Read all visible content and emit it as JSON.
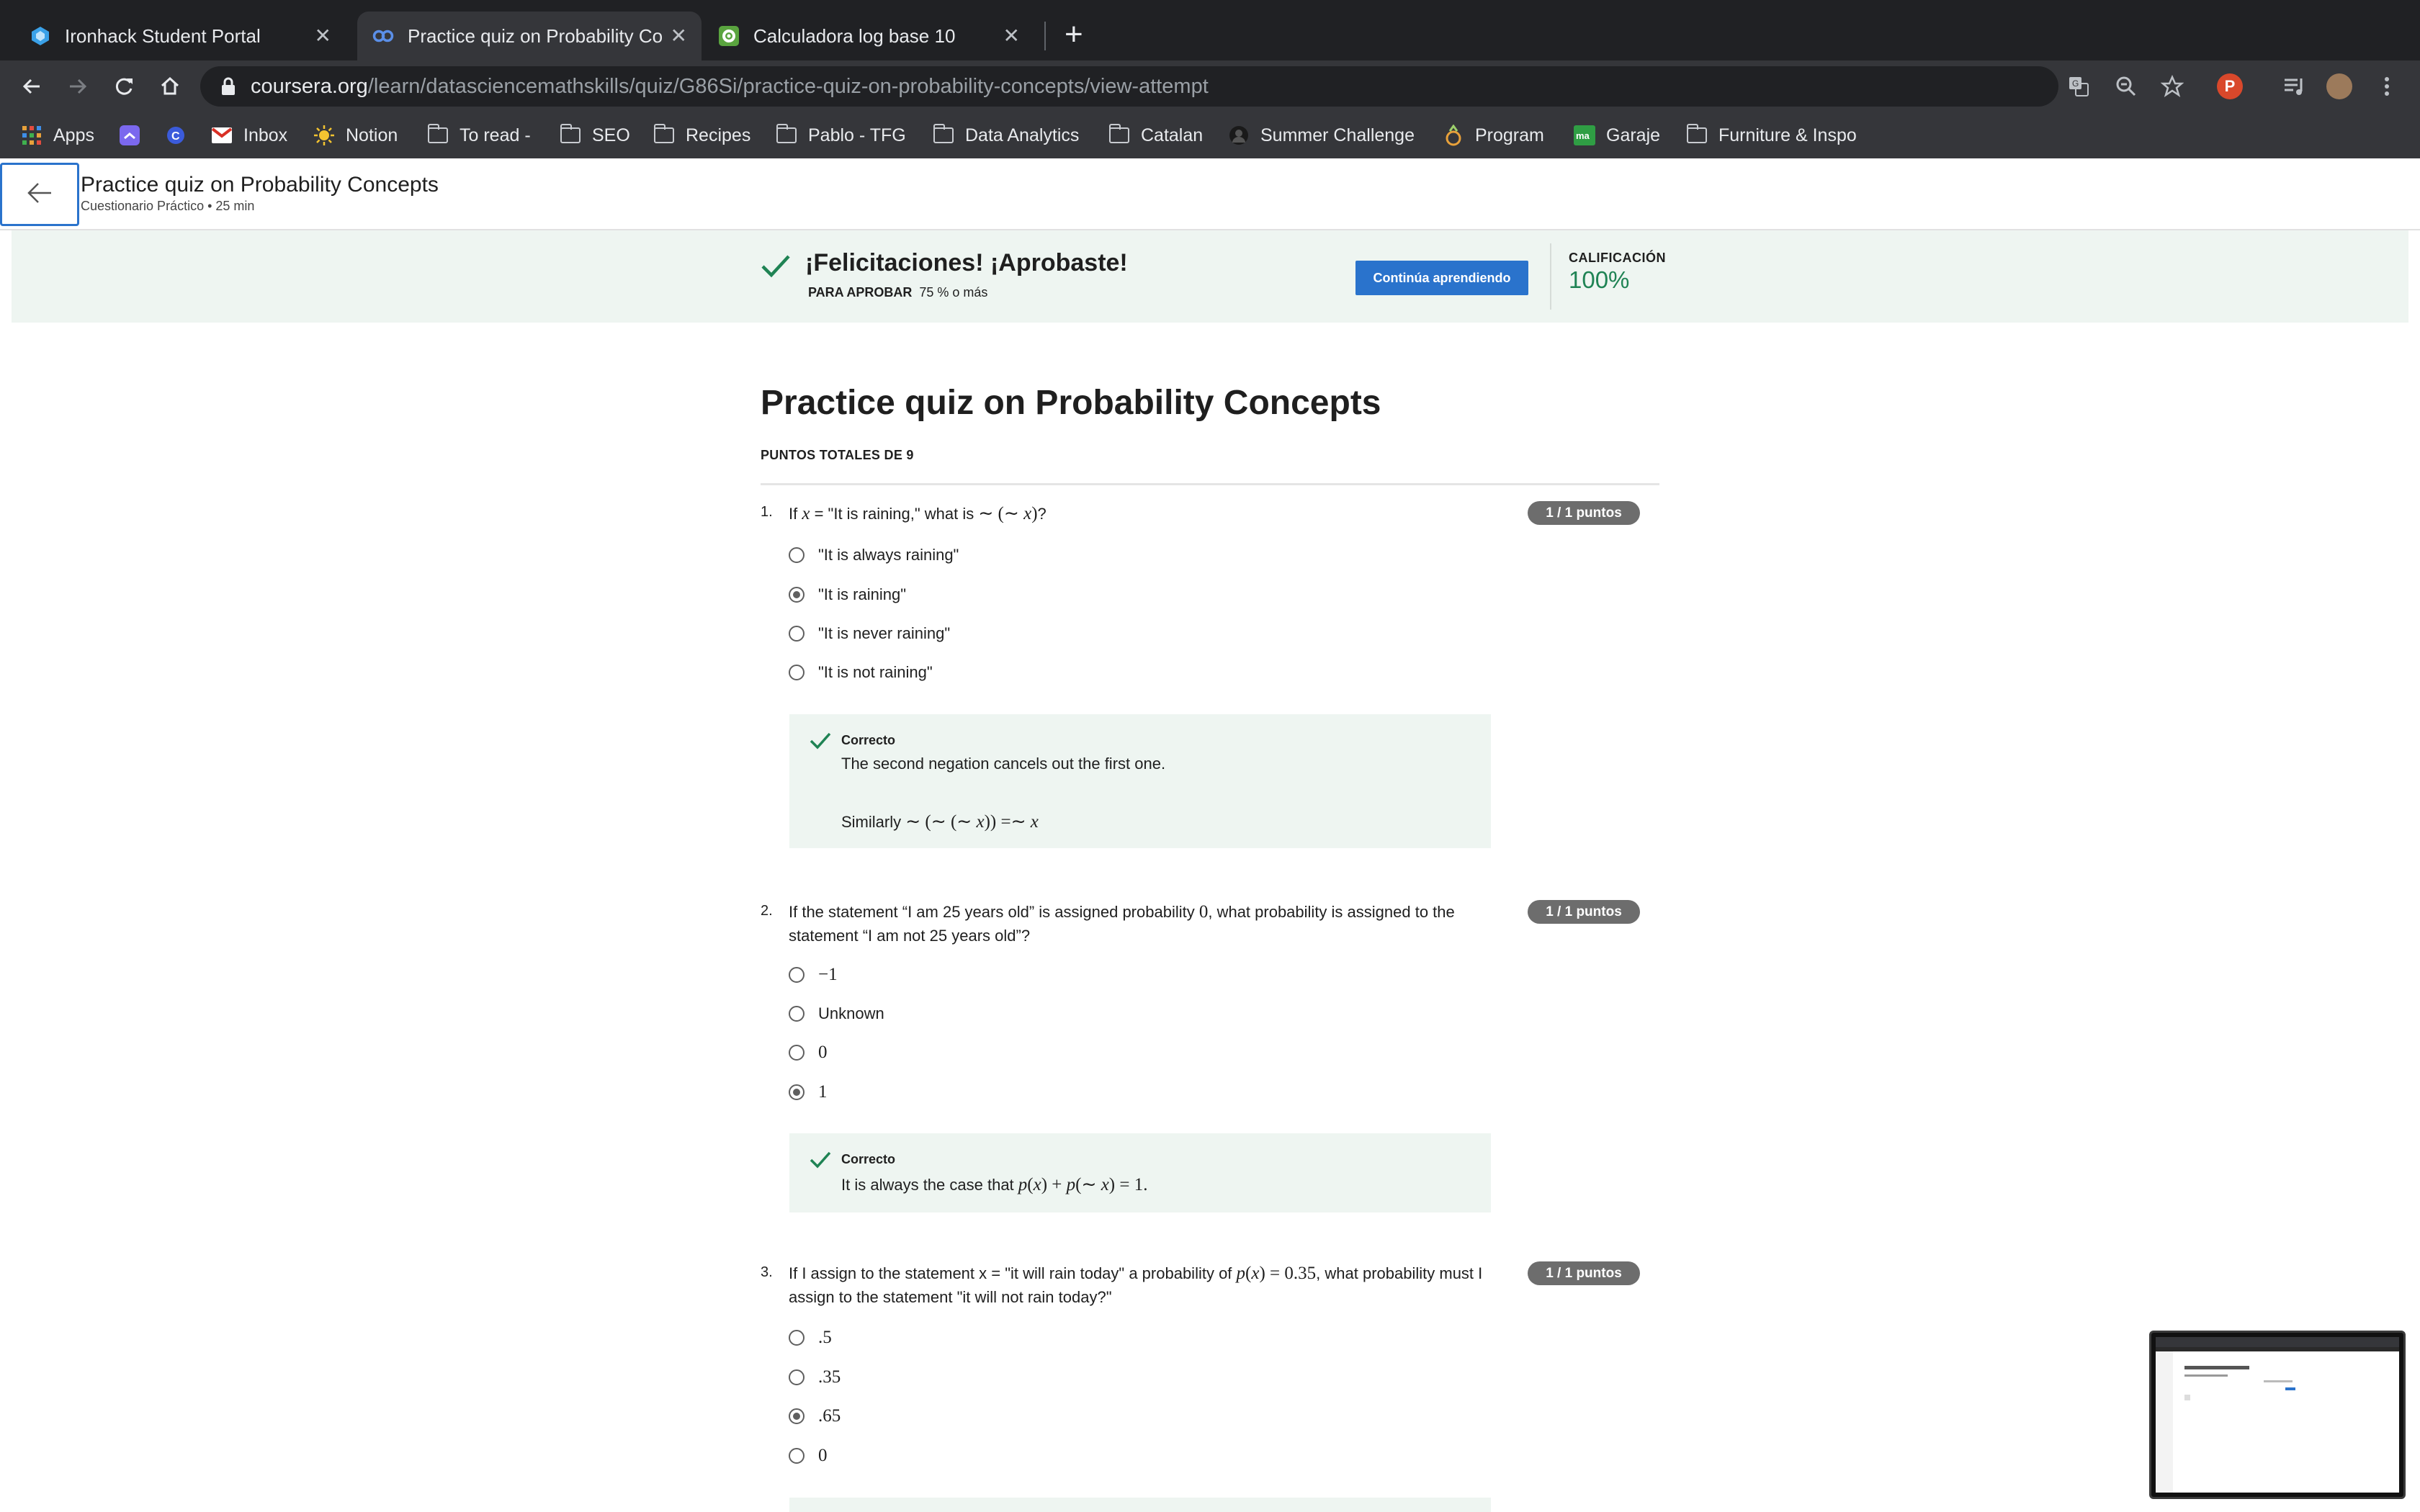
{
  "browser": {
    "tabs": [
      {
        "label": "Ironhack Student Portal",
        "icon": "ironhack-logo-icon",
        "active": false
      },
      {
        "label": "Practice quiz on Probability Co",
        "icon": "coursera-logo-icon",
        "active": true
      },
      {
        "label": "Calculadora log base 10",
        "icon": "calculator-gear-icon",
        "active": false
      }
    ],
    "url_host": "coursera.org",
    "url_path": "/learn/datasciencemathskills/quiz/G86Si/practice-quiz-on-probability-concepts/view-attempt",
    "profile_initial": "P",
    "bookmarks": [
      {
        "label": "Apps",
        "icon": "apps-grid-icon"
      },
      {
        "label": "",
        "icon": "clickup-icon"
      },
      {
        "label": "",
        "icon": "c-logo-icon"
      },
      {
        "label": "Inbox",
        "icon": "gmail-icon"
      },
      {
        "label": "Notion",
        "icon": "sun-icon"
      },
      {
        "label": "To read -",
        "icon": "folder-icon"
      },
      {
        "label": "SEO",
        "icon": "folder-icon"
      },
      {
        "label": "Recipes",
        "icon": "folder-icon"
      },
      {
        "label": "Pablo - TFG",
        "icon": "folder-icon"
      },
      {
        "label": "Data Analytics",
        "icon": "folder-icon"
      },
      {
        "label": "Catalan",
        "icon": "folder-icon"
      },
      {
        "label": "Summer Challenge",
        "icon": "avatar-icon"
      },
      {
        "label": "Program",
        "icon": "program-icon"
      },
      {
        "label": "Garaje",
        "icon": "ma-logo-icon"
      },
      {
        "label": "Furniture & Inspo",
        "icon": "folder-icon"
      }
    ]
  },
  "course_header": {
    "title": "Practice quiz on Probability Concepts",
    "subtitle": "Cuestionario Práctico • 25 min"
  },
  "banner": {
    "congrats": "¡Felicitaciones! ¡Aprobaste!",
    "pass_label": "PARA APROBAR",
    "pass_value": "75 % o más",
    "continue_label": "Continúa aprendiendo",
    "grade_label": "CALIFICACIÓN",
    "grade_value": "100%"
  },
  "quiz": {
    "title": "Practice quiz on Probability Concepts",
    "total_points": "PUNTOS TOTALES DE 9",
    "questions": [
      {
        "number": "1.",
        "points": "1 / 1 puntos",
        "text_a": "If ",
        "text_b": " = \"It is raining,\" what is ",
        "text_c": "?",
        "options": [
          "\"It is always raining\"",
          "\"It is raining\"",
          "\"It is never raining\"",
          "\"It is not raining\""
        ],
        "selected": 1,
        "feedback_title": "Correcto",
        "feedback_line1": "The second negation cancels out the first one.",
        "feedback_line2_prefix": "Similarly "
      },
      {
        "number": "2.",
        "points": "1 / 1 puntos",
        "text_a": "If the statement “I am 25 years old” is assigned probability ",
        "text_b": ", what probability is assigned to the statement “I am not 25 years old”?",
        "options": [
          "−1",
          "Unknown",
          "0",
          "1"
        ],
        "selected": 3,
        "feedback_title": "Correcto",
        "feedback_line1": "It is always the case that "
      },
      {
        "number": "3.",
        "points": "1 / 1 puntos",
        "text_a": "If I assign to the statement x = \"it will rain today\" a probability of ",
        "text_b": ", what probability must I assign to the statement \"it will not rain today?\"",
        "options": [
          ".5",
          ".35",
          ".65",
          "0"
        ],
        "selected": 2
      }
    ]
  },
  "colors": {
    "accent": "#2a73cc",
    "success": "#1f8354",
    "banner_bg": "#eef5f1",
    "points_badge": "#6d6d6d"
  }
}
